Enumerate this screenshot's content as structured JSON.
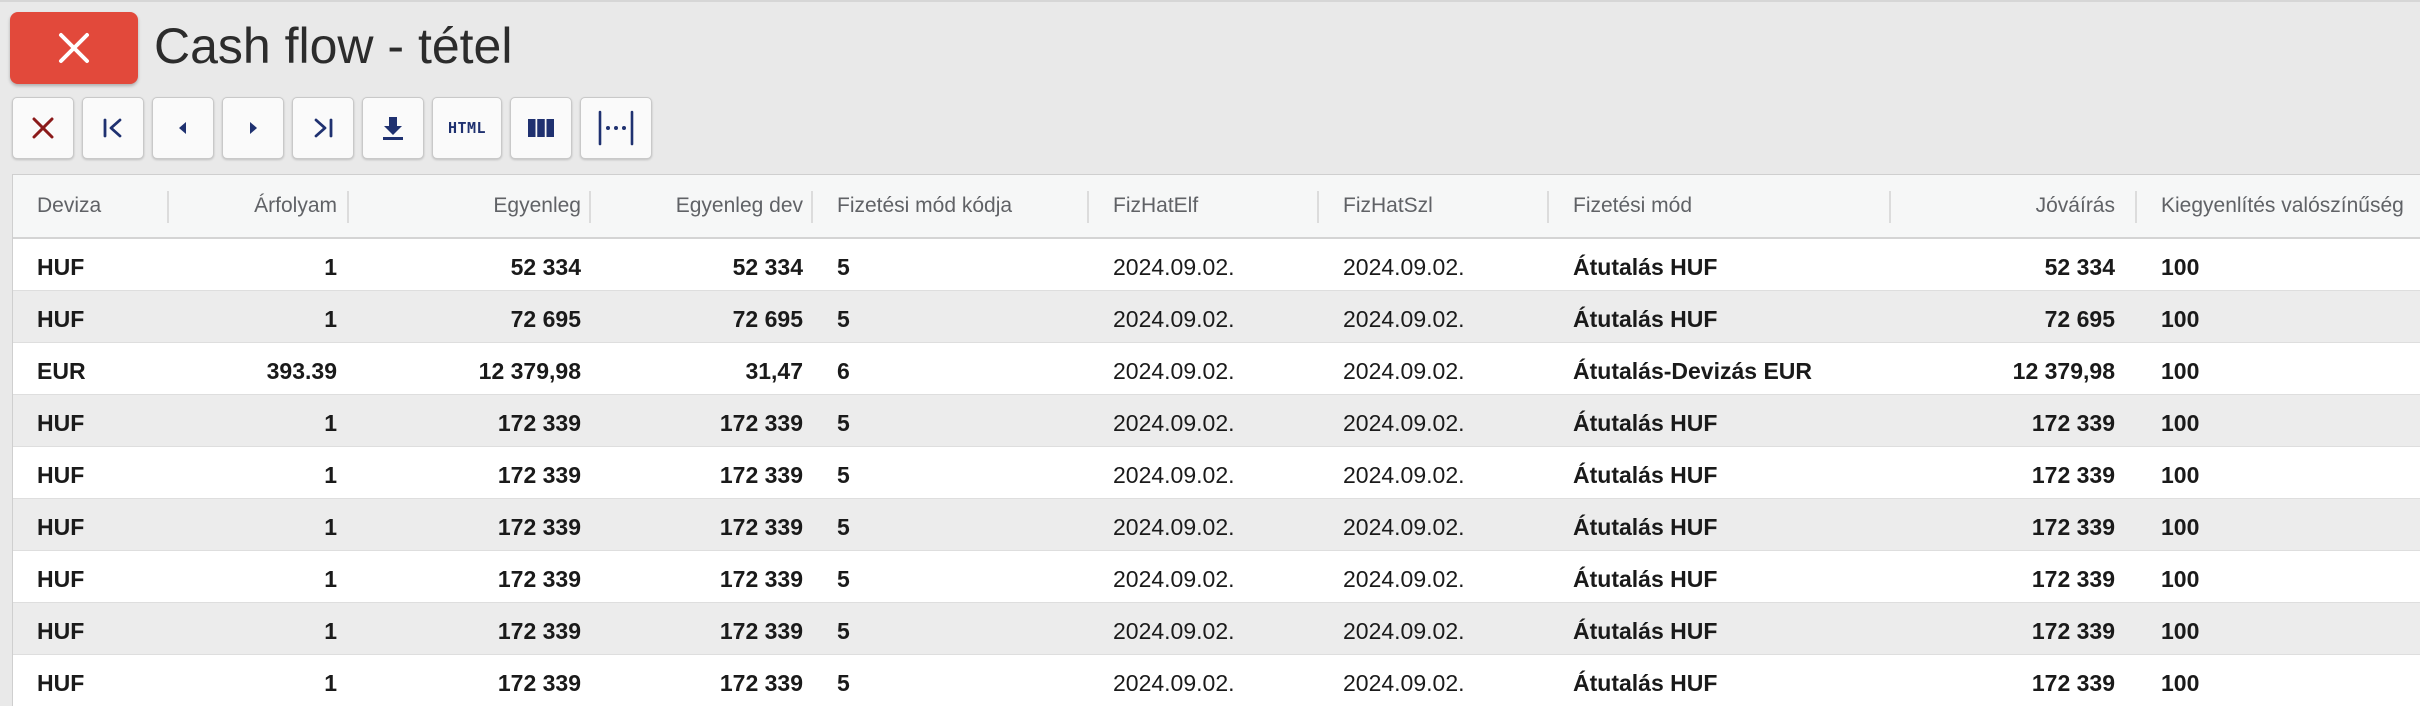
{
  "window": {
    "title": "Cash flow - tétel",
    "close_icon": "close-icon"
  },
  "toolbar": {
    "buttons": [
      {
        "name": "cancel-button",
        "icon": "x-icon",
        "color": "#8b1a1a"
      },
      {
        "name": "first-record-button",
        "icon": "first-icon"
      },
      {
        "name": "previous-record-button",
        "icon": "caret-left-icon"
      },
      {
        "name": "next-record-button",
        "icon": "caret-right-icon"
      },
      {
        "name": "last-record-button",
        "icon": "last-icon"
      },
      {
        "name": "download-button",
        "icon": "download-icon"
      },
      {
        "name": "export-html-button",
        "icon": "html-icon",
        "label": "HTML"
      },
      {
        "name": "columns-button",
        "icon": "columns-icon"
      },
      {
        "name": "separator-button",
        "icon": "separator-icon"
      }
    ],
    "accent": "#1f3170"
  },
  "grid": {
    "columns": [
      {
        "key": "deviza",
        "label": "Deviza"
      },
      {
        "key": "arfolyam",
        "label": "Árfolyam"
      },
      {
        "key": "egyenleg",
        "label": "Egyenleg"
      },
      {
        "key": "egyenleg_dev",
        "label": "Egyenleg dev"
      },
      {
        "key": "fizmod_kod",
        "label": "Fizetési mód kódja"
      },
      {
        "key": "fizhatelf",
        "label": "FizHatElf"
      },
      {
        "key": "fizhatszl",
        "label": "FizHatSzl"
      },
      {
        "key": "fizmod",
        "label": "Fizetési mód"
      },
      {
        "key": "jovairas",
        "label": "Jóváírás"
      },
      {
        "key": "kiegy",
        "label": "Kiegyenlítés valószínűség"
      }
    ],
    "rows": [
      {
        "deviza": "HUF",
        "arfolyam": "1",
        "egyenleg": "52 334",
        "egyenleg_dev": "52 334",
        "fizmod_kod": "5",
        "fizhatelf": "2024.09.02.",
        "fizhatszl": "2024.09.02.",
        "fizmod": "Átutalás HUF",
        "jovairas": "52 334",
        "kiegy": "100"
      },
      {
        "deviza": "HUF",
        "arfolyam": "1",
        "egyenleg": "72 695",
        "egyenleg_dev": "72 695",
        "fizmod_kod": "5",
        "fizhatelf": "2024.09.02.",
        "fizhatszl": "2024.09.02.",
        "fizmod": "Átutalás HUF",
        "jovairas": "72 695",
        "kiegy": "100"
      },
      {
        "deviza": "EUR",
        "arfolyam": "393.39",
        "egyenleg": "12 379,98",
        "egyenleg_dev": "31,47",
        "fizmod_kod": "6",
        "fizhatelf": "2024.09.02.",
        "fizhatszl": "2024.09.02.",
        "fizmod": "Átutalás-Devizás EUR",
        "jovairas": "12 379,98",
        "kiegy": "100"
      },
      {
        "deviza": "HUF",
        "arfolyam": "1",
        "egyenleg": "172 339",
        "egyenleg_dev": "172 339",
        "fizmod_kod": "5",
        "fizhatelf": "2024.09.02.",
        "fizhatszl": "2024.09.02.",
        "fizmod": "Átutalás HUF",
        "jovairas": "172 339",
        "kiegy": "100"
      },
      {
        "deviza": "HUF",
        "arfolyam": "1",
        "egyenleg": "172 339",
        "egyenleg_dev": "172 339",
        "fizmod_kod": "5",
        "fizhatelf": "2024.09.02.",
        "fizhatszl": "2024.09.02.",
        "fizmod": "Átutalás HUF",
        "jovairas": "172 339",
        "kiegy": "100"
      },
      {
        "deviza": "HUF",
        "arfolyam": "1",
        "egyenleg": "172 339",
        "egyenleg_dev": "172 339",
        "fizmod_kod": "5",
        "fizhatelf": "2024.09.02.",
        "fizhatszl": "2024.09.02.",
        "fizmod": "Átutalás HUF",
        "jovairas": "172 339",
        "kiegy": "100"
      },
      {
        "deviza": "HUF",
        "arfolyam": "1",
        "egyenleg": "172 339",
        "egyenleg_dev": "172 339",
        "fizmod_kod": "5",
        "fizhatelf": "2024.09.02.",
        "fizhatszl": "2024.09.02.",
        "fizmod": "Átutalás HUF",
        "jovairas": "172 339",
        "kiegy": "100"
      },
      {
        "deviza": "HUF",
        "arfolyam": "1",
        "egyenleg": "172 339",
        "egyenleg_dev": "172 339",
        "fizmod_kod": "5",
        "fizhatelf": "2024.09.02.",
        "fizhatszl": "2024.09.02.",
        "fizmod": "Átutalás HUF",
        "jovairas": "172 339",
        "kiegy": "100"
      },
      {
        "deviza": "HUF",
        "arfolyam": "1",
        "egyenleg": "172 339",
        "egyenleg_dev": "172 339",
        "fizmod_kod": "5",
        "fizhatelf": "2024.09.02.",
        "fizhatszl": "2024.09.02.",
        "fizmod": "Átutalás HUF",
        "jovairas": "172 339",
        "kiegy": "100"
      }
    ]
  },
  "colors": {
    "close_button": "#e2493b",
    "row_alt": "#ececec",
    "header_bg": "#f6f7f7"
  }
}
